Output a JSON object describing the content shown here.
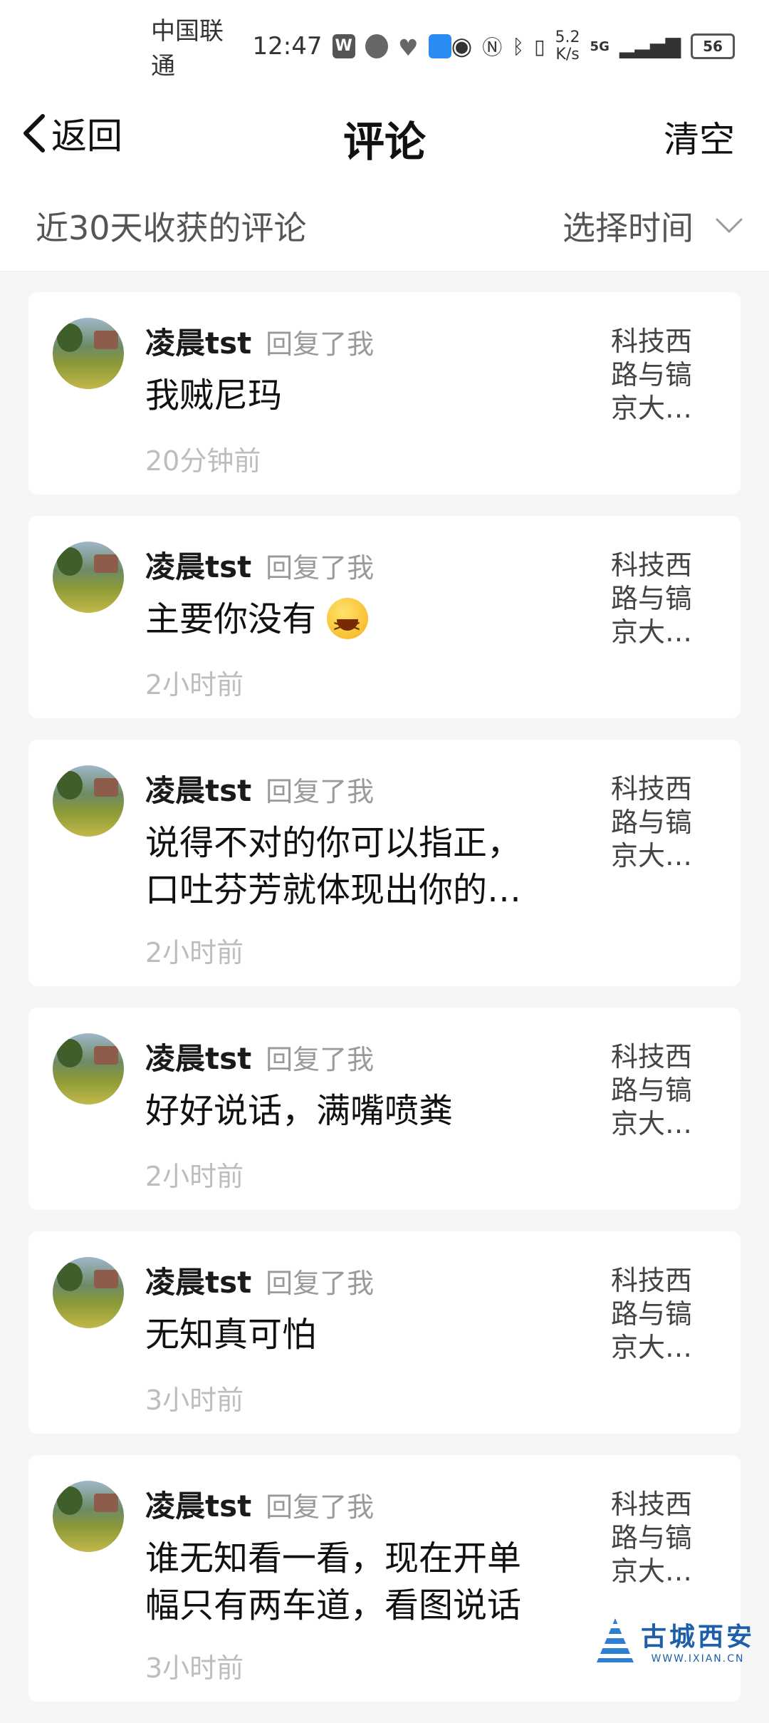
{
  "status_bar": {
    "carrier": "中国联通",
    "time": "12:47",
    "net_speed_value": "5.2",
    "net_speed_unit": "K/s",
    "network": "5G",
    "battery": "56"
  },
  "nav": {
    "back_label": "返回",
    "title": "评论",
    "clear_label": "清空"
  },
  "filter": {
    "title": "近30天收获的评论",
    "select_label": "选择时间"
  },
  "comments": [
    {
      "user": "凌晨tst",
      "action": "回复了我",
      "line1": "我贼尼玛",
      "line2": "",
      "time": "20分钟前",
      "loc1": "科技西",
      "loc2": "路与镐",
      "loc3": "京大…"
    },
    {
      "user": "凌晨tst",
      "action": "回复了我",
      "line1": "主要你没有",
      "line2": "",
      "time": "2小时前",
      "loc1": "科技西",
      "loc2": "路与镐",
      "loc3": "京大…"
    },
    {
      "user": "凌晨tst",
      "action": "回复了我",
      "line1": "说得不对的你可以指正，",
      "line2": "口吐芬芳就体现出你的…",
      "time": "2小时前",
      "loc1": "科技西",
      "loc2": "路与镐",
      "loc3": "京大…"
    },
    {
      "user": "凌晨tst",
      "action": "回复了我",
      "line1": "好好说话，满嘴喷粪",
      "line2": "",
      "time": "2小时前",
      "loc1": "科技西",
      "loc2": "路与镐",
      "loc3": "京大…"
    },
    {
      "user": "凌晨tst",
      "action": "回复了我",
      "line1": "无知真可怕",
      "line2": "",
      "time": "3小时前",
      "loc1": "科技西",
      "loc2": "路与镐",
      "loc3": "京大…"
    },
    {
      "user": "凌晨tst",
      "action": "回复了我",
      "line1": "谁无知看一看，现在开单",
      "line2": "幅只有两车道，看图说话",
      "time": "3小时前",
      "loc1": "科技西",
      "loc2": "路与镐",
      "loc3": "京大…"
    }
  ],
  "watermark": {
    "main": "古城西安",
    "sub": "WWW.IXIAN.CN"
  }
}
